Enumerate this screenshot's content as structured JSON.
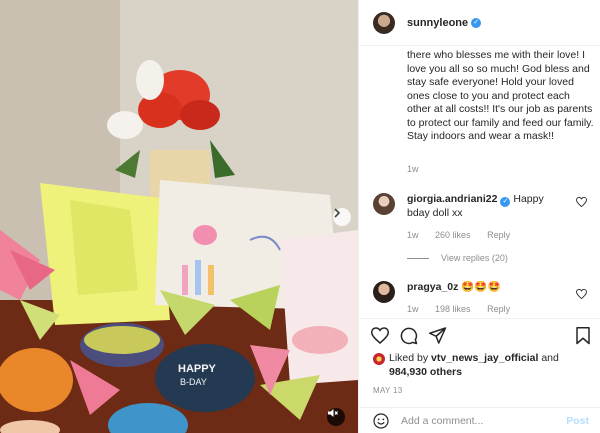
{
  "post": {
    "username": "sunnyleone",
    "caption": "there who blesses me with their love! I love you all so so much! God bless and stay safe everyone! Hold your loved ones close to you and protect each other at all costs!! It's our job as parents to protect our family and feed our family. Stay indoors and wear a mask!!",
    "caption_time": "1w",
    "date": "MAY 13",
    "liked_by_prefix": "Liked by ",
    "liked_by_user": "vtv_news_jay_official",
    "liked_by_mid": " and",
    "liked_by_count": "984,930 others"
  },
  "comments": [
    {
      "username": "giorgia.andriani22",
      "text": "Happy bday doll xx",
      "time": "1w",
      "likes": "260 likes",
      "reply": "Reply",
      "view_replies": "View replies (20)"
    },
    {
      "username": "pragya_0z",
      "text": "🤩🤩🤩",
      "time": "1w",
      "likes": "198 likes",
      "reply": "Reply"
    }
  ],
  "composer": {
    "placeholder": "Add a comment...",
    "post_label": "Post"
  },
  "icons": {
    "next": "chevron-right-icon",
    "mute": "muted-speaker-icon",
    "like": "heart-icon",
    "comment": "comment-icon",
    "share": "share-icon",
    "save": "bookmark-icon",
    "emoji": "smiley-icon",
    "verified": "verified-badge-icon"
  },
  "colors": {
    "link_blue": "#3897f0",
    "post_disabled": "#b2dffc",
    "muted_text": "#8e8e8e"
  }
}
